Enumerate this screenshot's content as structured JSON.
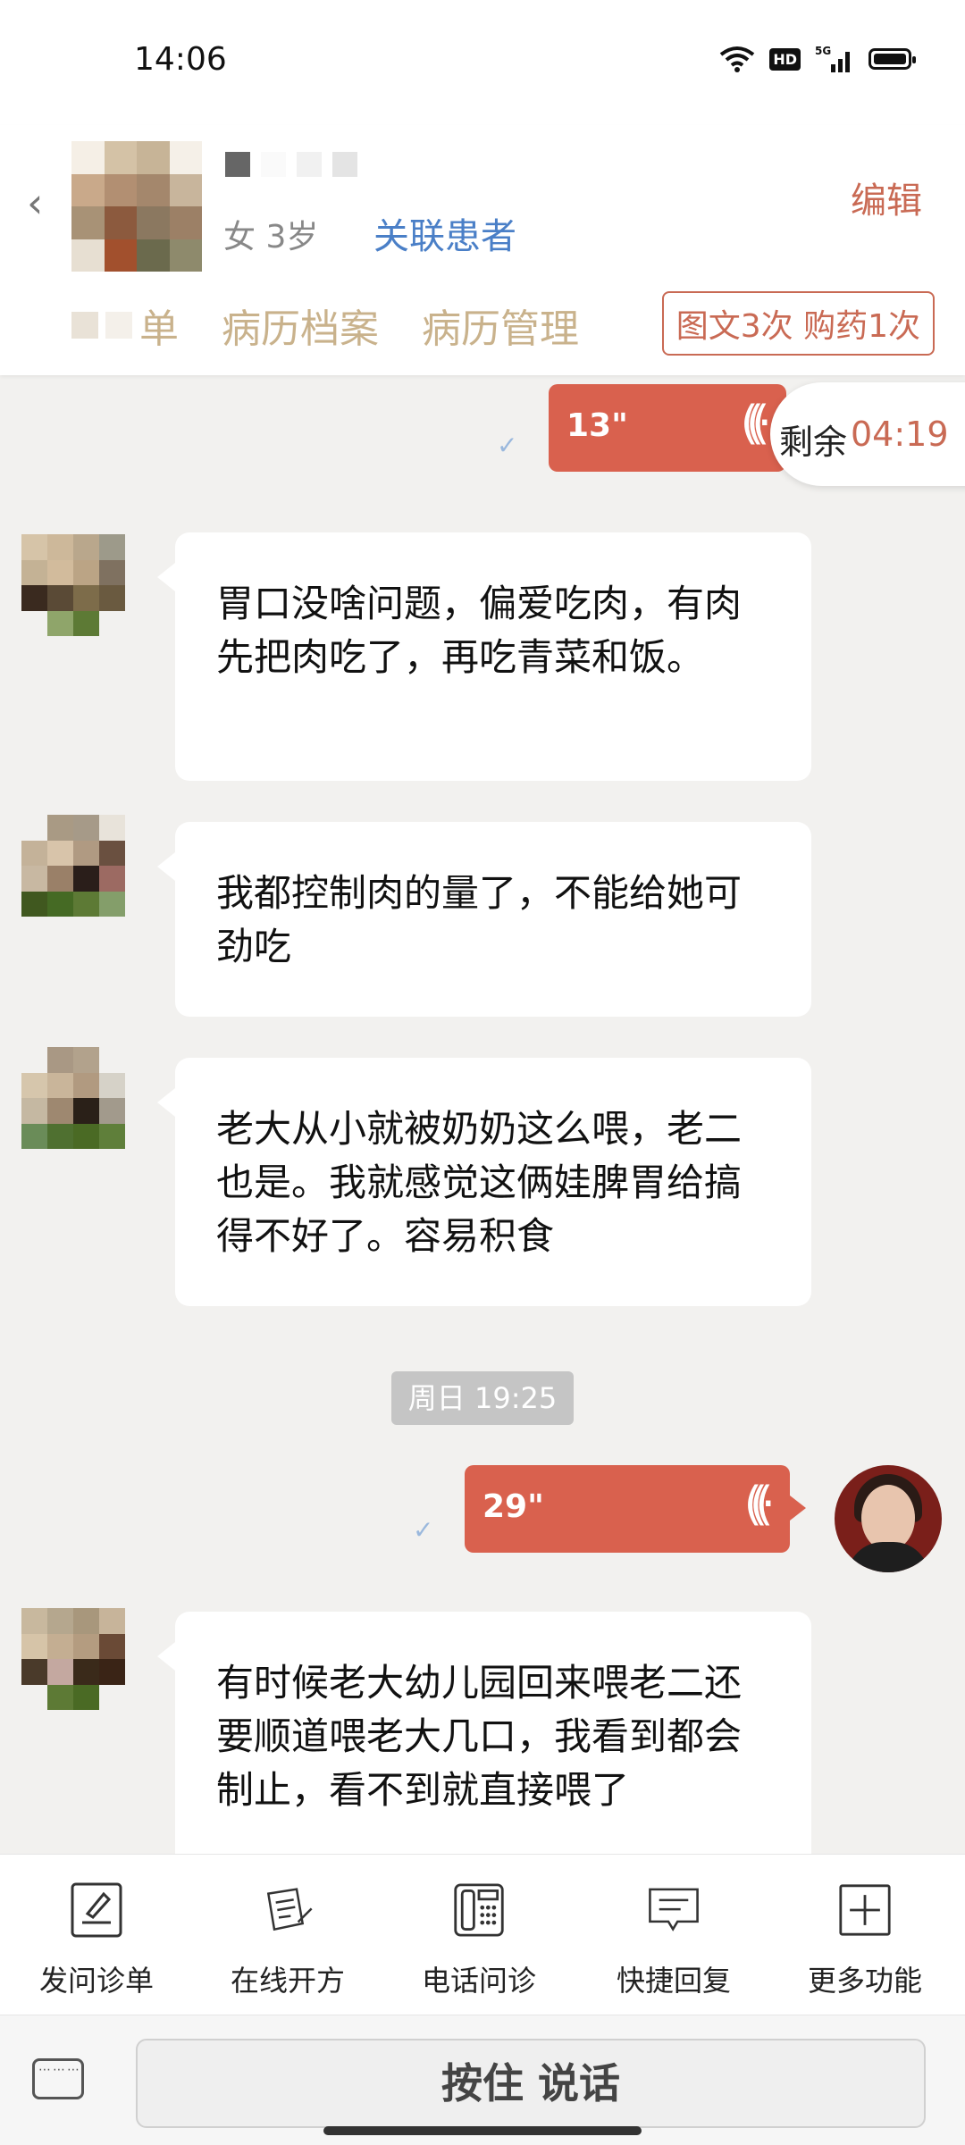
{
  "status_bar": {
    "time": "14:06",
    "network": "5G",
    "hd": "HD"
  },
  "patient": {
    "info": "女 3岁",
    "link_label": "关联患者",
    "edit_label": "编辑"
  },
  "tabs": [
    {
      "label": "单"
    },
    {
      "label": "病历档案"
    },
    {
      "label": "病历管理"
    }
  ],
  "quota": "图文3次 购药1次",
  "remaining": {
    "label": "剩余",
    "time": "04:19"
  },
  "messages": {
    "voice1": {
      "duration": "13\""
    },
    "text1": "胃口没啥问题，偏爱吃肉，有肉先把肉吃了，再吃青菜和饭。",
    "text2": "我都控制肉的量了，不能给她可劲吃",
    "text3": "老大从小就被奶奶这么喂，老二也是。我就感觉这俩娃脾胃给搞得不好了。容易积食",
    "timestamp": "周日 19:25",
    "voice2": {
      "duration": "29\""
    },
    "text4": "有时候老大幼儿园回来喂老二还要顺道喂老大几口，我看到都会制止，看不到就直接喂了"
  },
  "toolbar": [
    {
      "label": "发问诊单",
      "icon": "form-icon"
    },
    {
      "label": "在线开方",
      "icon": "prescription-icon"
    },
    {
      "label": "电话问诊",
      "icon": "phone-icon"
    },
    {
      "label": "快捷回复",
      "icon": "quick-reply-icon"
    },
    {
      "label": "更多功能",
      "icon": "plus-icon"
    }
  ],
  "input": {
    "talk_label": "按住 说话"
  },
  "colors": {
    "accent": "#d9614e",
    "link": "#4a7fc7",
    "tab": "#c9b28c"
  }
}
